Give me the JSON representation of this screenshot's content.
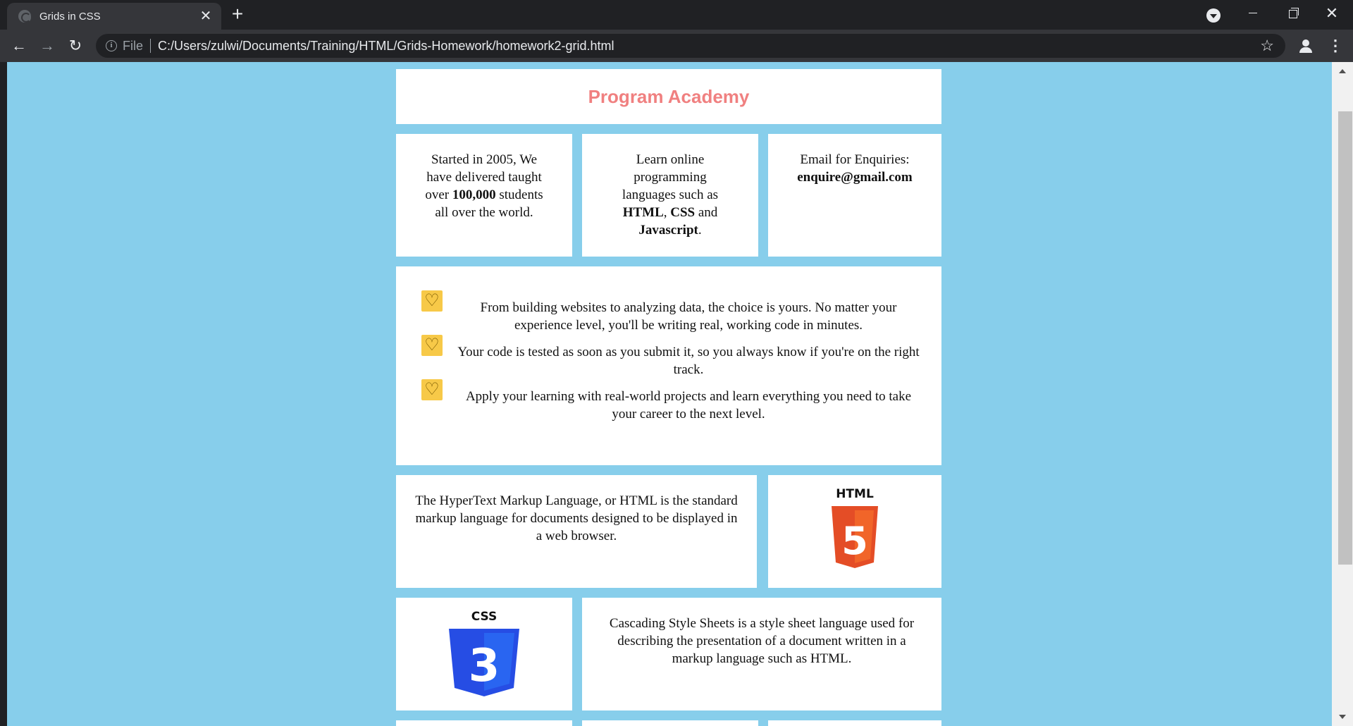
{
  "browser": {
    "tab_title": "Grids in CSS",
    "tab_close": "✕",
    "new_tab": "+",
    "file_label": "File",
    "url": "C:/Users/zulwi/Documents/Training/HTML/Grids-Homework/homework2-grid.html"
  },
  "page": {
    "title": "Program Academy",
    "info1": {
      "pre": "Started in 2005, We have delivered taught over ",
      "bold": "100,000",
      "post": " students all over the world."
    },
    "info2": {
      "pre": "Learn online programming languages such as ",
      "b1": "HTML",
      "comma": ", ",
      "b2": "CSS",
      "and": " and ",
      "b3": "Javascript",
      "end": "."
    },
    "info3": {
      "label": "Email for Enquiries:",
      "email": "enquire@gmail.com"
    },
    "features": [
      "From building websites to analyzing data, the choice is yours. No matter your experience level, you'll be writing real, working code in minutes.",
      "Your code is tested as soon as you submit it, so you always know if you're on the right track.",
      "Apply your learning with real-world projects and learn everything you need to take your career to the next level."
    ],
    "html_text": "The HyperText Markup Language, or HTML is the standard markup language for documents designed to be displayed in a web browser.",
    "html_logo": {
      "caption": "HTML",
      "numeral": "5"
    },
    "css_logo": {
      "caption": "CSS",
      "numeral": "3"
    },
    "css_text": "Cascading Style Sheets is a style sheet language used for describing the presentation of a document written in a markup language such as HTML."
  },
  "colors": {
    "background": "#87ceeb",
    "title": "#f08080",
    "html_orange": "#e44d26",
    "css_blue": "#264de4",
    "heart_icon": "#f7c948"
  },
  "icons": [
    "heart-icon",
    "html5-logo",
    "css3-logo",
    "info-icon",
    "star-icon",
    "account-icon",
    "menu-icon"
  ]
}
